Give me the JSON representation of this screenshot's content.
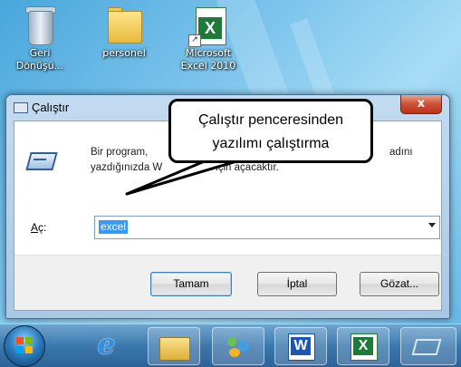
{
  "desktop": {
    "icons": [
      {
        "label_line1": "Geri",
        "label_line2": "Dönüşü...",
        "icon": "recycle-bin-icon"
      },
      {
        "label_line1": "personel",
        "label_line2": "",
        "icon": "folder-icon"
      },
      {
        "label_line1": "Microsoft",
        "label_line2": "Excel 2010",
        "icon": "excel-icon"
      }
    ]
  },
  "dialog": {
    "title": "Çalıştır",
    "close_label": "x",
    "description_line1": "Bir program,",
    "description_line1_tail": "adını",
    "description_line2": "yazdığınızda W",
    "description_line2_tail": "sizin için açacaktır.",
    "open_label_accel": "A",
    "open_label_rest": "ç:",
    "open_value": "excel",
    "buttons": {
      "ok": "Tamam",
      "cancel": "İptal",
      "browse": "Gözat..."
    }
  },
  "callout": {
    "line1": "Çalıştır penceresinden",
    "line2": "yazılımı çalıştırma"
  },
  "taskbar": {
    "items": [
      "start-orb-icon",
      "internet-explorer-icon",
      "folder-icon",
      "people-icon",
      "word-icon",
      "excel-icon",
      "run-icon"
    ],
    "word_letter": "W",
    "excel_letter": "X"
  },
  "colors": {
    "selection": "#3399ff",
    "close_button": "#c8452a",
    "taskbar": "#3b78ad"
  }
}
